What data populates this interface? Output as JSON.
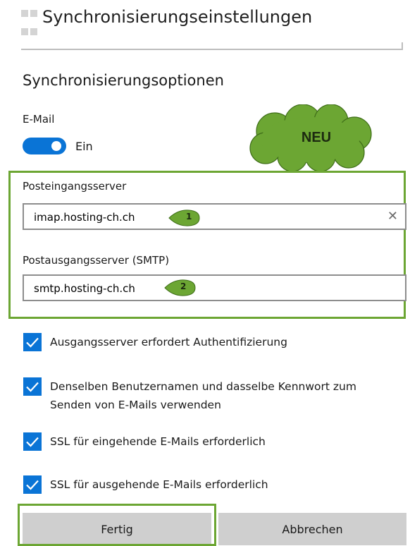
{
  "header": {
    "title": "Synchronisierungseinstellungen",
    "icon": "app-icon"
  },
  "sync": {
    "heading": "Synchronisierungsoptionen",
    "email_label": "E-Mail",
    "email_toggle": {
      "on": true,
      "state_label": "Ein",
      "color": "#0a74d6"
    }
  },
  "annotation": {
    "cloud_text": "NEU",
    "cloud_color": "#6ca633",
    "highlight_color": "#6ca633"
  },
  "servers": {
    "incoming_label": "Posteingangsserver",
    "incoming_value": "imap.hosting-ch.ch",
    "incoming_marker": "1",
    "outgoing_label": "Postausgangsserver (SMTP)",
    "outgoing_value": "smtp.hosting-ch.ch",
    "outgoing_marker": "2",
    "clear_icon": "close-icon"
  },
  "checkboxes": [
    {
      "label": "Ausgangsserver erfordert Authentifizierung",
      "checked": true
    },
    {
      "label": "Denselben Benutzernamen und dasselbe Kennwort zum",
      "label_line2": "Senden von E-Mails verwenden",
      "checked": true
    },
    {
      "label": "SSL für eingehende E-Mails erforderlich",
      "checked": true
    },
    {
      "label": "SSL für ausgehende E-Mails erforderlich",
      "checked": true
    }
  ],
  "footer": {
    "done_label": "Fertig",
    "cancel_label": "Abbrechen"
  }
}
